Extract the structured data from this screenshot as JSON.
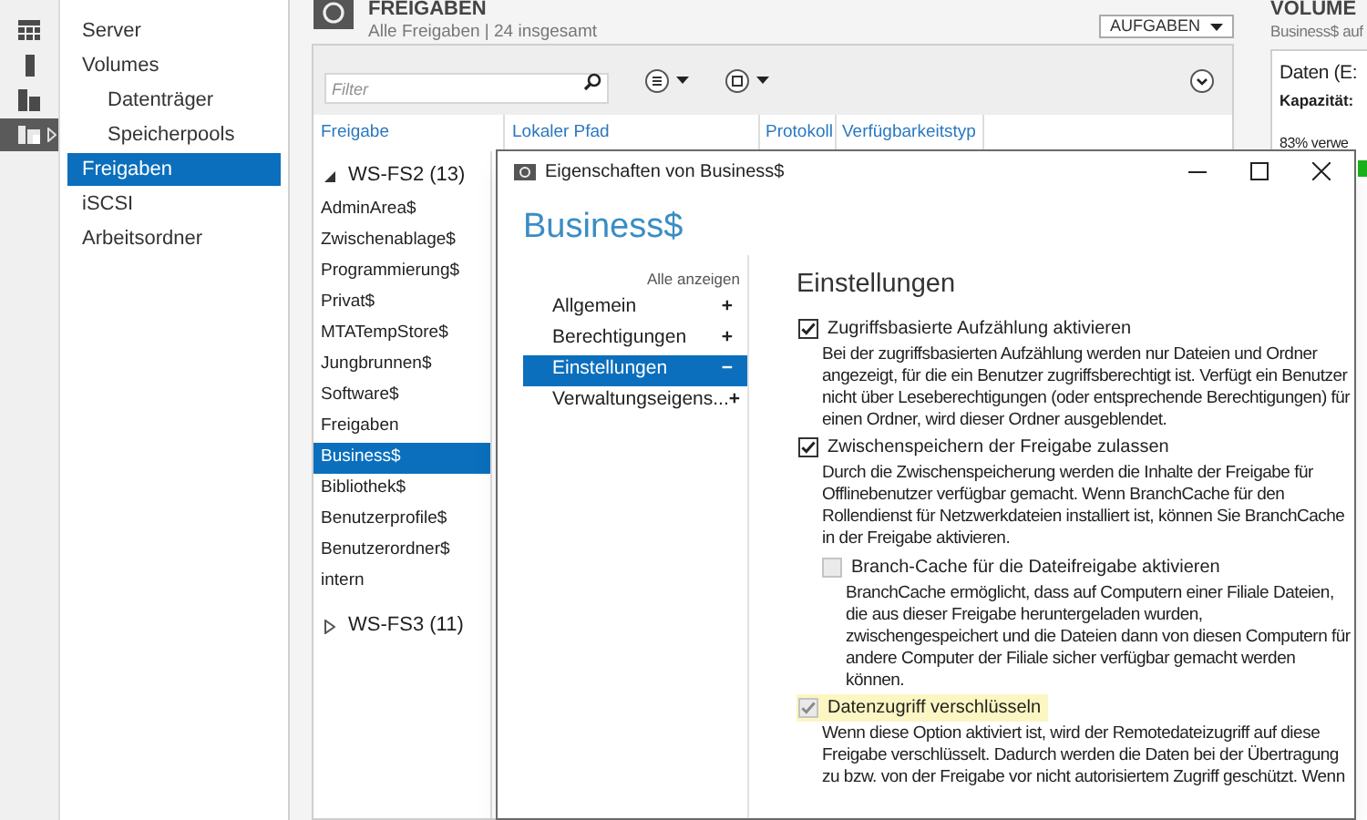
{
  "nav_icons": [
    {
      "selected": false
    },
    {
      "selected": false
    },
    {
      "selected": false
    },
    {
      "selected": true
    }
  ],
  "nav": {
    "items": [
      {
        "label": "Server",
        "selected": false
      },
      {
        "label": "Volumes",
        "selected": false,
        "children": [
          {
            "label": "Datenträger",
            "selected": false
          },
          {
            "label": "Speicherpools",
            "selected": false
          }
        ]
      },
      {
        "label": "Freigaben",
        "selected": true
      },
      {
        "label": "iSCSI",
        "selected": false
      },
      {
        "label": "Arbeitsordner",
        "selected": false
      }
    ]
  },
  "shares_panel": {
    "title": "FREIGABEN",
    "subtitle": "Alle Freigaben | 24 insgesamt",
    "tasks_button": "AUFGABEN",
    "filter": {
      "placeholder": "Filter"
    },
    "columns": [
      "Freigabe",
      "Lokaler Pfad",
      "Protokoll",
      "Verfügbarkeitstyp"
    ],
    "groups": [
      {
        "label": "WS-FS2 (13)",
        "expanded": true,
        "rows": [
          {
            "name": "AdminArea$",
            "selected": false
          },
          {
            "name": "Zwischenablage$",
            "selected": false
          },
          {
            "name": "Programmierung$",
            "selected": false
          },
          {
            "name": "Privat$",
            "selected": false
          },
          {
            "name": "MTATempStore$",
            "selected": false
          },
          {
            "name": "Jungbrunnen$",
            "selected": false
          },
          {
            "name": "Software$",
            "selected": false
          },
          {
            "name": "Freigaben",
            "selected": false
          },
          {
            "name": "Business$",
            "selected": true
          },
          {
            "name": "Bibliothek$",
            "selected": false
          },
          {
            "name": "Benutzerprofile$",
            "selected": false
          },
          {
            "name": "Benutzerordner$",
            "selected": false
          },
          {
            "name": "intern",
            "selected": false
          }
        ]
      },
      {
        "label": "WS-FS3 (11)",
        "expanded": false
      }
    ]
  },
  "volume_panel": {
    "title": "VOLUME",
    "subtitle": "Business$ auf",
    "volume": "Daten (E:",
    "capacity_label": "Kapazität:",
    "usage": "83% verwe"
  },
  "dialog": {
    "title": "Eigenschaften von Business$",
    "heading": "Business$",
    "show_all": "Alle anzeigen",
    "sections": [
      {
        "label": "Allgemein",
        "sign": "+",
        "selected": false
      },
      {
        "label": "Berechtigungen",
        "sign": "+",
        "selected": false
      },
      {
        "label": "Einstellungen",
        "sign": "−",
        "selected": true
      },
      {
        "label": "Verwaltungseigens...",
        "sign": "+",
        "selected": false
      }
    ],
    "content_title": "Einstellungen",
    "options": [
      {
        "label": "Zugriffsbasierte Aufzählung aktivieren",
        "checked": true,
        "disabled": false,
        "highlighted": false,
        "description": "Bei der zugriffsbasierten Aufzählung werden nur Dateien und Ordner angezeigt, für die ein Benutzer zugriffsberechtigt ist. Verfügt ein Benutzer nicht über Leseberechtigungen (oder entsprechende Berechtigungen) für einen Ordner, wird dieser Ordner ausgeblendet."
      },
      {
        "label": "Zwischenspeichern der Freigabe zulassen",
        "checked": true,
        "disabled": false,
        "highlighted": false,
        "description": "Durch die Zwischenspeicherung werden die Inhalte der Freigabe für Offlinebenutzer verfügbar gemacht. Wenn BranchCache für den Rollendienst für Netzwerkdateien installiert ist, können Sie BranchCache in der Freigabe aktivieren.",
        "children": [
          {
            "label": "Branch-Cache für die Dateifreigabe aktivieren",
            "checked": false,
            "disabled": true,
            "highlighted": false,
            "description": "BranchCache ermöglicht, dass auf Computern einer Filiale Dateien, die aus dieser Freigabe heruntergeladen wurden, zwischengespeichert und die Dateien dann von diesen Computern für andere Computer der Filiale sicher verfügbar gemacht werden können."
          }
        ]
      },
      {
        "label": "Datenzugriff verschlüsseln",
        "checked": true,
        "disabled": true,
        "highlighted": true,
        "description": "Wenn diese Option aktiviert ist, wird der Remotedateizugriff auf diese Freigabe verschlüsselt. Dadurch werden die Daten bei der Übertragung zu bzw. von der Freigabe vor nicht autorisiertem Zugriff geschützt. Wenn"
      }
    ]
  }
}
